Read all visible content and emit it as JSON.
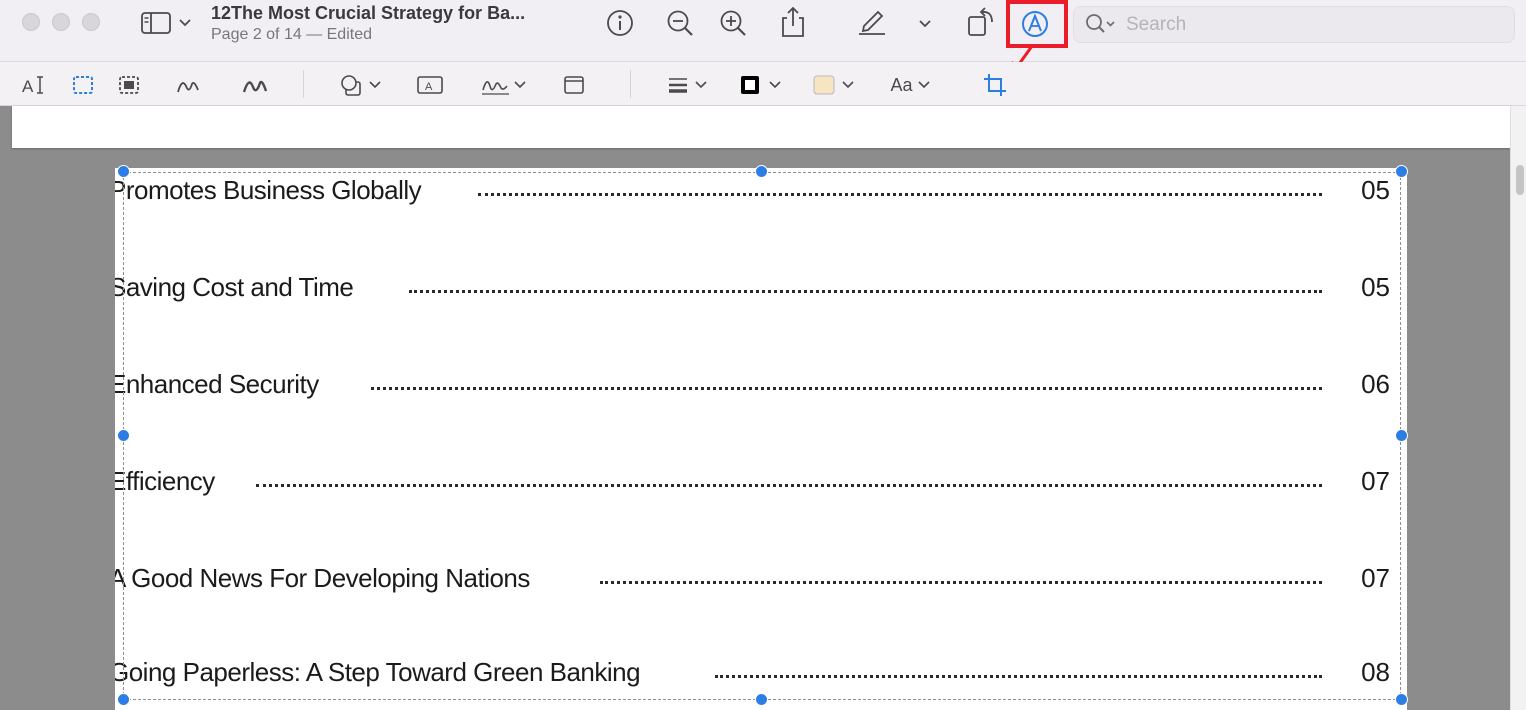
{
  "window": {
    "title": "12The Most Crucial Strategy for Ba...",
    "subtitle": "Page 2 of 14 — Edited"
  },
  "search": {
    "placeholder": "Search"
  },
  "markup_toolbar": {
    "text_style_label": "Aa",
    "tools": [
      "text-selection",
      "rectangular-selection",
      "instant-alpha",
      "sketch",
      "draw",
      "shapes",
      "text-box",
      "sign",
      "note",
      "shape-style",
      "border-color",
      "fill-color",
      "text-style",
      "crop"
    ]
  },
  "colors": {
    "accent": "#2d7ee2",
    "highlight": "#ea1e2b",
    "fill_swatch": "#f7e4c0"
  },
  "toc": {
    "entries": [
      {
        "label": "Promotes Business Globally",
        "page": "05"
      },
      {
        "label": "Saving Cost and Time",
        "page": "05"
      },
      {
        "label": "Enhanced Security",
        "page": "06"
      },
      {
        "label": "Efficiency",
        "page": "07"
      },
      {
        "label": "A Good News For Developing Nations",
        "page": "07"
      },
      {
        "label": "Going Paperless: A Step Toward Green Banking",
        "page": "08"
      }
    ]
  }
}
